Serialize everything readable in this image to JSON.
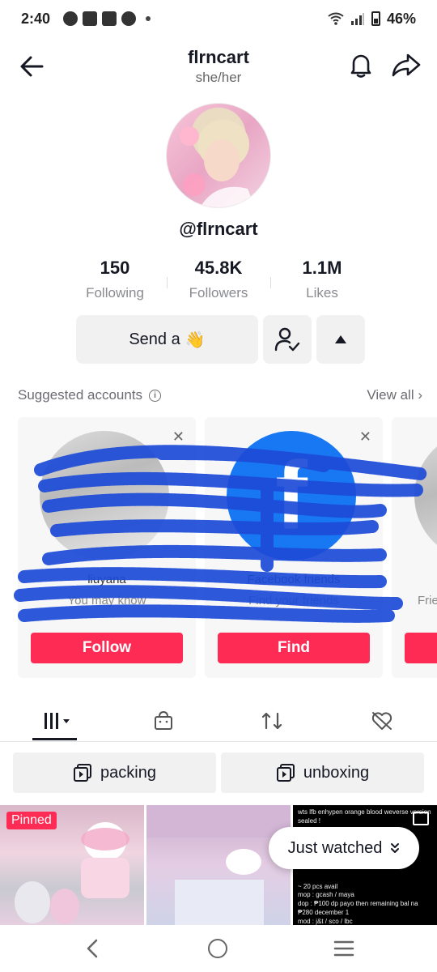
{
  "status": {
    "time": "2:40",
    "battery": "46%"
  },
  "header": {
    "title": "flrncart",
    "pronouns": "she/her"
  },
  "profile": {
    "handle": "@flrncart"
  },
  "stats": [
    {
      "value": "150",
      "label": "Following"
    },
    {
      "value": "45.8K",
      "label": "Followers"
    },
    {
      "value": "1.1M",
      "label": "Likes"
    }
  ],
  "actions": {
    "send_label": "Send a",
    "send_emoji": "👋"
  },
  "suggested": {
    "title": "Suggested accounts",
    "view_all": "View all",
    "cards": [
      {
        "name": "liuyana",
        "sub": "You may know",
        "button": "Follow"
      },
      {
        "name": "Facebook friends",
        "sub": "Find your friends",
        "button": "Find"
      },
      {
        "name": "",
        "sub": "Frie",
        "button": ""
      }
    ]
  },
  "playlists": [
    {
      "label": "packing"
    },
    {
      "label": "unboxing"
    }
  ],
  "videos": {
    "pinned_label": "Pinned",
    "caption_lines": [
      "wts lfb enhypen orange blood weverse version",
      "sealed !",
      "~ 20 pcs avail",
      "mop : gcash / maya",
      "dop : ₱100 dp payo then remaining bal na",
      "₱280 december 1",
      "mod : j&t / sco / lbc"
    ],
    "just_watched": "Just watched"
  },
  "colors": {
    "accent": "#fe2c55",
    "facebook": "#1877f2",
    "scribble": "#1d4bd8"
  }
}
